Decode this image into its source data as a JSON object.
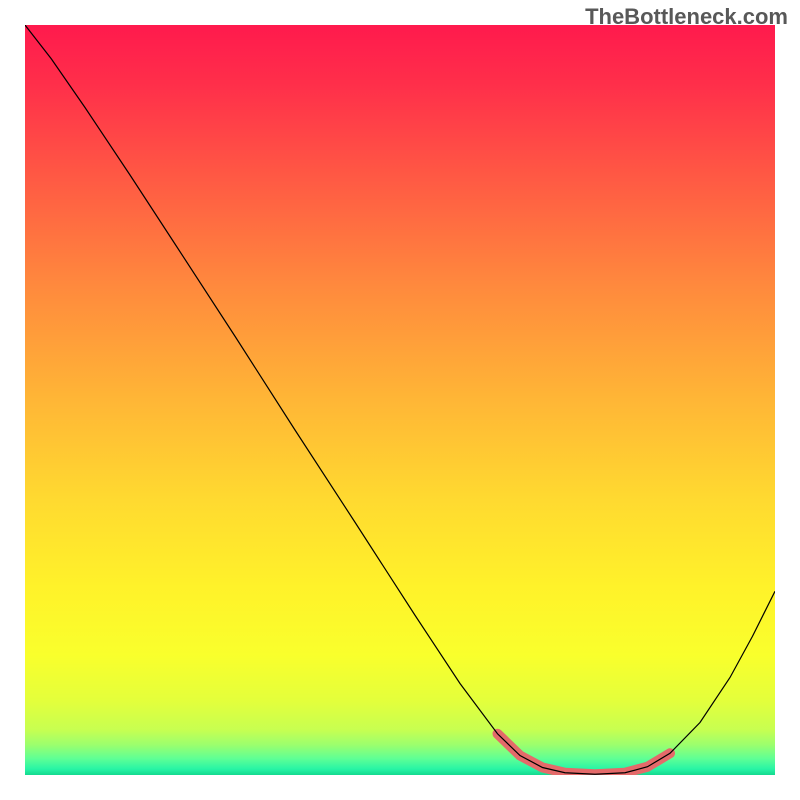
{
  "watermark": "TheBottleneck.com",
  "gradient_stops": [
    {
      "offset": 0,
      "color": "#ff1a4d"
    },
    {
      "offset": 0.08,
      "color": "#ff2f4a"
    },
    {
      "offset": 0.2,
      "color": "#ff5844"
    },
    {
      "offset": 0.35,
      "color": "#ff8a3d"
    },
    {
      "offset": 0.5,
      "color": "#ffb636"
    },
    {
      "offset": 0.63,
      "color": "#ffd930"
    },
    {
      "offset": 0.75,
      "color": "#fff22a"
    },
    {
      "offset": 0.84,
      "color": "#f9ff2c"
    },
    {
      "offset": 0.9,
      "color": "#e4ff3b"
    },
    {
      "offset": 0.939,
      "color": "#c8ff50"
    },
    {
      "offset": 0.96,
      "color": "#9bff6e"
    },
    {
      "offset": 0.978,
      "color": "#5fff95"
    },
    {
      "offset": 0.992,
      "color": "#28f5a5"
    },
    {
      "offset": 1.0,
      "color": "#14d98f"
    }
  ],
  "chart_data": {
    "type": "line",
    "title": "",
    "xlabel": "",
    "ylabel": "",
    "xlim": [
      0,
      100
    ],
    "ylim": [
      0,
      100
    ],
    "grid": false,
    "series": [
      {
        "name": "bottleneck-curve",
        "color": "#000000",
        "width": 1.2,
        "points": [
          {
            "x": 0.0,
            "y": 100.0
          },
          {
            "x": 3.5,
            "y": 95.5
          },
          {
            "x": 8.0,
            "y": 89.0
          },
          {
            "x": 14.0,
            "y": 80.0
          },
          {
            "x": 20.0,
            "y": 70.8
          },
          {
            "x": 28.0,
            "y": 58.5
          },
          {
            "x": 36.0,
            "y": 46.0
          },
          {
            "x": 44.0,
            "y": 33.7
          },
          {
            "x": 52.0,
            "y": 21.3
          },
          {
            "x": 58.0,
            "y": 12.2
          },
          {
            "x": 63.0,
            "y": 5.5
          },
          {
            "x": 66.0,
            "y": 2.6
          },
          {
            "x": 69.0,
            "y": 1.0
          },
          {
            "x": 72.0,
            "y": 0.3
          },
          {
            "x": 76.0,
            "y": 0.1
          },
          {
            "x": 80.0,
            "y": 0.3
          },
          {
            "x": 83.0,
            "y": 1.1
          },
          {
            "x": 86.0,
            "y": 2.9
          },
          {
            "x": 90.0,
            "y": 7.0
          },
          {
            "x": 94.0,
            "y": 13.0
          },
          {
            "x": 97.0,
            "y": 18.5
          },
          {
            "x": 100.0,
            "y": 24.5
          }
        ]
      },
      {
        "name": "optimal-range-marker",
        "color": "#e46a6a",
        "width": 10,
        "linecap": "round",
        "points": [
          {
            "x": 63.0,
            "y": 5.5
          },
          {
            "x": 66.0,
            "y": 2.6
          },
          {
            "x": 69.0,
            "y": 1.0
          },
          {
            "x": 72.0,
            "y": 0.3
          },
          {
            "x": 76.0,
            "y": 0.1
          },
          {
            "x": 80.0,
            "y": 0.3
          },
          {
            "x": 83.0,
            "y": 1.1
          },
          {
            "x": 86.0,
            "y": 2.9
          }
        ]
      }
    ]
  }
}
